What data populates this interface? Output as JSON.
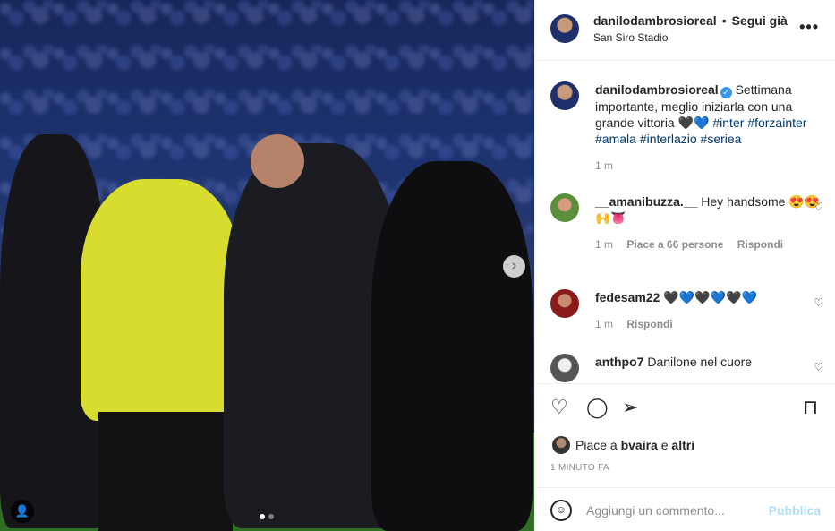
{
  "header": {
    "username": "danilodambrosioreal",
    "separator": "•",
    "follow_label": "Segui già",
    "location": "San Siro Stadio",
    "more_icon": "more-horizontal-icon"
  },
  "caption": {
    "username": "danilodambrosioreal",
    "text": "Settimana importante, meglio iniziarla con una grande vittoria 🖤💙",
    "hashtags": [
      "#inter",
      "#forzainter",
      "#amala",
      "#interlazio",
      "#seriea"
    ],
    "time": "1 m"
  },
  "comments": [
    {
      "username": "__amanibuzza.__",
      "text": "Hey handsome 😍😍🙌👅",
      "time": "1 m",
      "likes": "Piace a 66 persone",
      "reply": "Rispondi"
    },
    {
      "username": "fedesam22",
      "text": "🖤💙🖤💙🖤💙",
      "time": "1 m",
      "reply": "Rispondi"
    },
    {
      "username": "anthpo7",
      "text": "Danilone nel cuore"
    }
  ],
  "actions": {
    "likes_prefix": "Piace a",
    "likes_user": "bvaira",
    "likes_and": "e",
    "likes_others": "altri",
    "timestamp": "1 MINUTO FA"
  },
  "add_comment": {
    "placeholder": "Aggiungi un commento...",
    "post_label": "Pubblica"
  },
  "photo": {
    "carousel_dots": 2,
    "active_dot": 1
  },
  "colors": {
    "link": "#00376b",
    "post_disabled": "#b2dffc",
    "muted": "#8e8e8e",
    "verified": "#3897f0"
  }
}
